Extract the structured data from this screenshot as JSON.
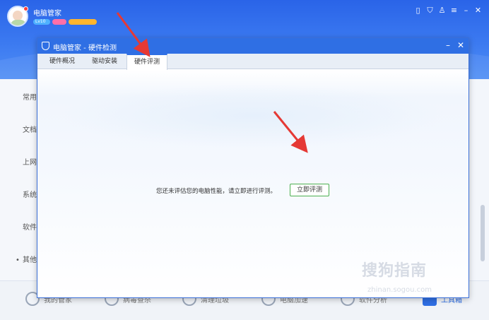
{
  "app": {
    "name": "电脑管家",
    "badges": [
      "Lv10",
      "",
      ""
    ],
    "sidebar": [
      "常用",
      "文档",
      "上网",
      "系统",
      "软件",
      "其他"
    ],
    "bottom": [
      "我的管家",
      "病毒查杀",
      "清理垃圾",
      "电脑加速",
      "软件分析",
      "工具箱"
    ]
  },
  "dialog": {
    "title": "电脑管家 - 硬件检测",
    "tabs": [
      "硬件概况",
      "驱动安装",
      "硬件评测"
    ],
    "active_tab": "硬件评测",
    "message": "您还未评估您的电脑性能，请立即进行评测。",
    "button": "立即评测"
  },
  "watermark": {
    "brand": "搜狗指南",
    "url": "zhinan.sogou.com"
  },
  "colors": {
    "brand_blue": "#2f6fe4",
    "button_border": "#4caf50",
    "annotation_red": "#e53935"
  },
  "icons": {
    "title_shield": "shield-icon",
    "minimize": "minimize-icon",
    "close": "close-icon"
  }
}
